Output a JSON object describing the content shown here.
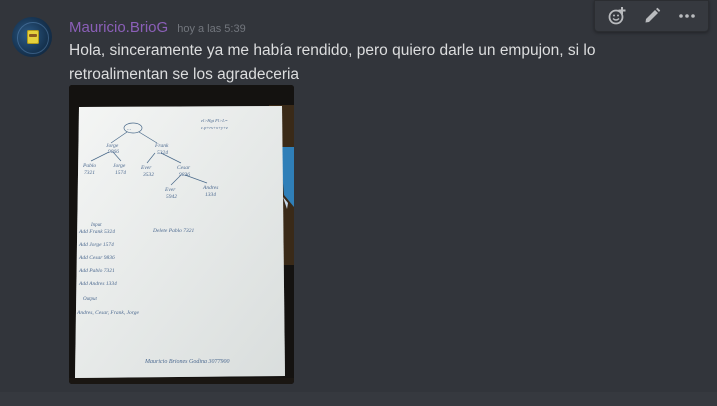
{
  "message": {
    "author": "Mauricio.BrioG",
    "timestamp": "hoy a las 5:39",
    "text": "Hola, sinceramente ya me había rendido, pero quiero darle un empujon, si lo retroalimentan se los agradeceria"
  },
  "toolbar": {
    "icons": [
      "add-reaction-icon",
      "edit-icon",
      "more-options-icon"
    ]
  },
  "attachment": {
    "handwriting": {
      "tree_root": "...",
      "n1": "Jorge",
      "n1_num": "9866",
      "n2": "Frank",
      "n2_num": "5324",
      "n3": "Pablo",
      "n3_num": "7321",
      "n4": "Jorge",
      "n4_num": "1574",
      "n5": "Cesar",
      "n5_num": "9836",
      "n6": "Ever",
      "n6_num": "3532",
      "n7": "Ever",
      "n7_num": "5942",
      "n8": "Andres",
      "n8_num": "1334",
      "input_label": "Input",
      "add1": "Add  Frank  5324",
      "add2": "Add  Jorge  1574",
      "add3": "Add  Cesar  9836",
      "add4": "Add  Pablo  7321",
      "add5": "Add  Andres  1334",
      "delete": "Delete  Pablo  7321",
      "output_label": "Output",
      "output": "Andres, Cesar, Frank, Jorge",
      "signature": "Mauricio Briones Godina   3077900",
      "corner_note_1": "el>Hgt  Fl>L=",
      "corner_note_2": "c.p+rs+x+y+z"
    }
  }
}
